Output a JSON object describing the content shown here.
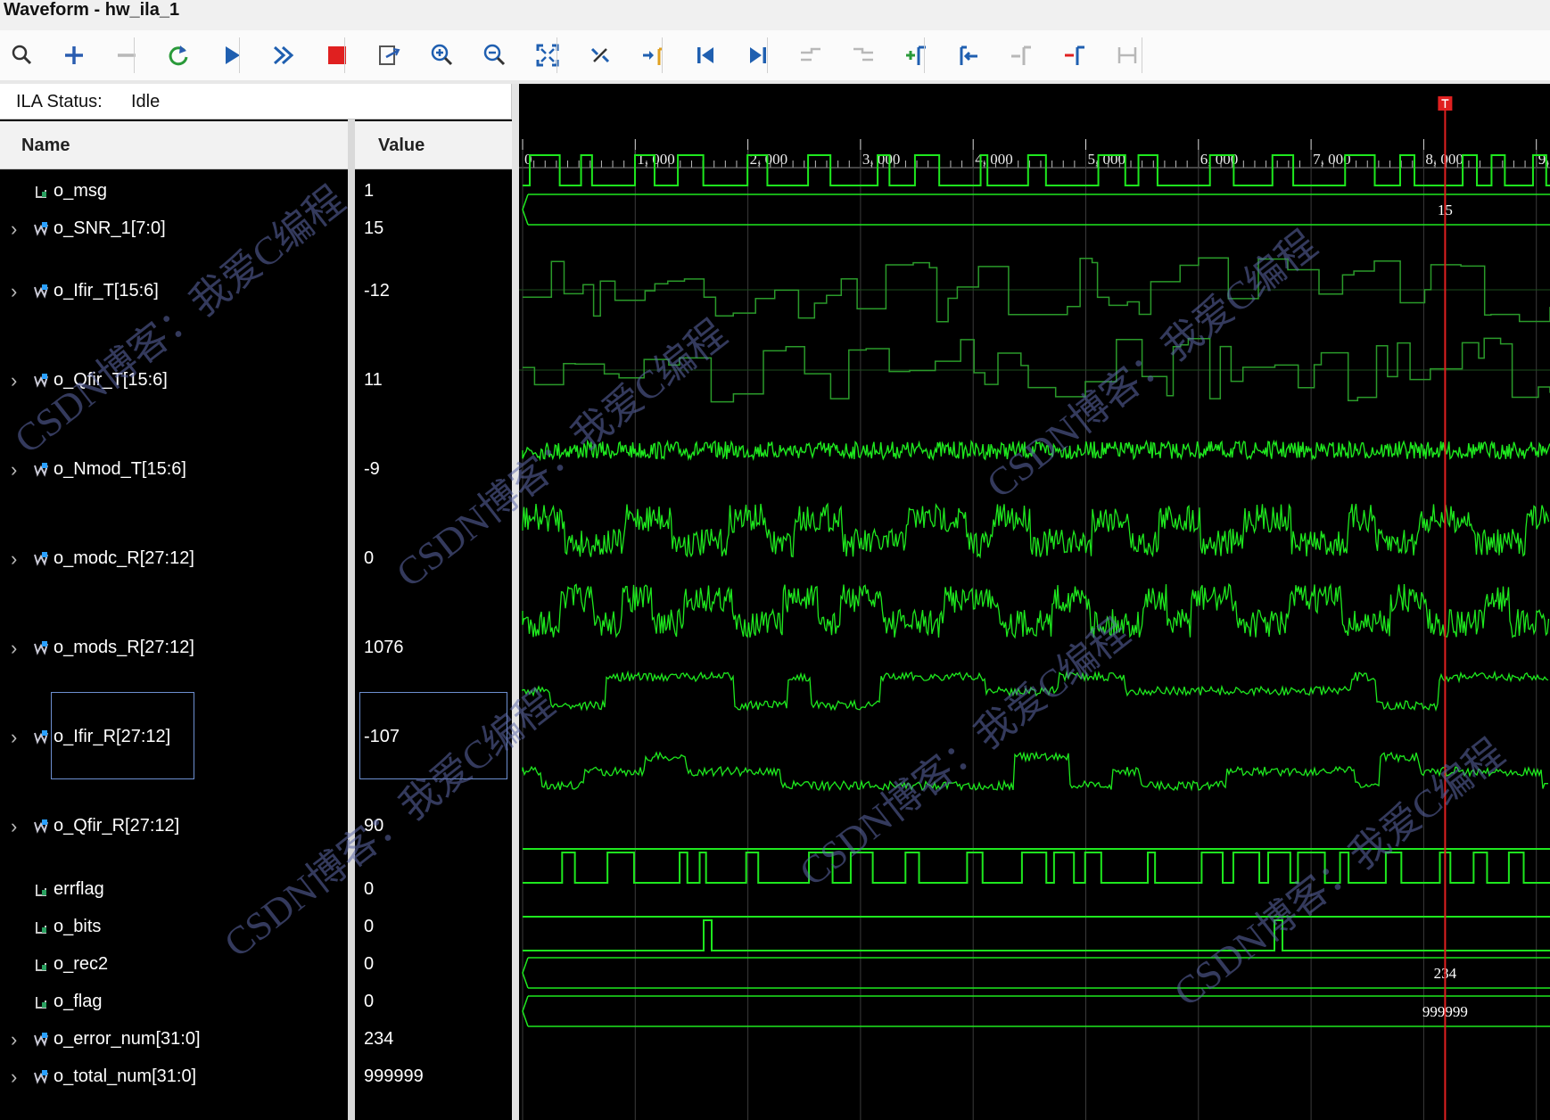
{
  "window": {
    "title": "Waveform - hw_ila_1"
  },
  "toolbar": {
    "buttons": [
      {
        "name": "search-button",
        "icon": "search-icon"
      },
      {
        "name": "add-button",
        "icon": "plus-icon"
      },
      {
        "name": "remove-button",
        "icon": "minus-icon"
      },
      {
        "name": "run-trigger-button",
        "icon": "refresh-icon"
      },
      {
        "name": "run-button",
        "icon": "play-icon"
      },
      {
        "name": "run-immediate-button",
        "icon": "fast-forward-icon"
      },
      {
        "name": "stop-button",
        "icon": "stop-icon"
      },
      {
        "name": "export-button",
        "icon": "export-icon"
      },
      {
        "name": "zoom-in-button",
        "icon": "zoom-in-icon"
      },
      {
        "name": "zoom-out-button",
        "icon": "zoom-out-icon"
      },
      {
        "name": "zoom-fit-button",
        "icon": "zoom-fit-icon"
      },
      {
        "name": "zoom-cursor-button",
        "icon": "cursor-zoom-icon"
      },
      {
        "name": "go-to-cursor-button",
        "icon": "go-to-cursor-icon"
      },
      {
        "name": "go-to-start-button",
        "icon": "go-to-start-icon"
      },
      {
        "name": "go-to-end-button",
        "icon": "go-to-end-icon"
      },
      {
        "name": "previous-transition-button",
        "icon": "previous-transition-icon"
      },
      {
        "name": "next-transition-button",
        "icon": "next-transition-icon"
      },
      {
        "name": "add-marker-button",
        "icon": "add-marker-icon"
      },
      {
        "name": "previous-marker-button",
        "icon": "previous-marker-icon"
      },
      {
        "name": "next-marker-button",
        "icon": "next-marker-icon"
      },
      {
        "name": "delete-marker-button",
        "icon": "delete-marker-icon"
      },
      {
        "name": "swap-cursors-button",
        "icon": "swap-cursors-icon"
      }
    ]
  },
  "status": {
    "label": "ILA Status:",
    "value": "Idle"
  },
  "columns": {
    "name": "Name",
    "value": "Value"
  },
  "signals": [
    {
      "name": "o_msg",
      "value": "1",
      "bus": false,
      "kind": "bit"
    },
    {
      "name": "o_SNR_1[7:0]",
      "value": "15",
      "bus": true,
      "kind": "busval"
    },
    {
      "name": "o_Ifir_T[15:6]",
      "value": "-12",
      "bus": true,
      "kind": "analog_step"
    },
    {
      "name": "o_Qfir_T[15:6]",
      "value": "11",
      "bus": true,
      "kind": "analog_step"
    },
    {
      "name": "o_Nmod_T[15:6]",
      "value": "-9",
      "bus": true,
      "kind": "noise"
    },
    {
      "name": "o_modc_R[27:12]",
      "value": "0",
      "bus": true,
      "kind": "noisy_bin"
    },
    {
      "name": "o_mods_R[27:12]",
      "value": "1076",
      "bus": true,
      "kind": "noisy_bin"
    },
    {
      "name": "o_Ifir_R[27:12]",
      "value": "-107",
      "bus": true,
      "kind": "noisy_step"
    },
    {
      "name": "o_Qfir_R[27:12]",
      "value": "90",
      "bus": true,
      "kind": "noisy_step"
    },
    {
      "name": "errflag",
      "value": "0",
      "bus": false,
      "kind": "bit"
    },
    {
      "name": "o_bits",
      "value": "0",
      "bus": false,
      "kind": "bit"
    },
    {
      "name": "o_rec2",
      "value": "0",
      "bus": false,
      "kind": "bit"
    },
    {
      "name": "o_flag",
      "value": "0",
      "bus": false,
      "kind": "bit"
    },
    {
      "name": "o_error_num[31:0]",
      "value": "234",
      "bus": true,
      "kind": "busval"
    },
    {
      "name": "o_total_num[31:0]",
      "value": "999999",
      "bus": true,
      "kind": "busval"
    }
  ],
  "waveform": {
    "ticks": [
      "0",
      "1, 000",
      "2, 000",
      "3, 000",
      "4, 000",
      "5, 000",
      "6, 000",
      "7, 000",
      "8, 000",
      "9,"
    ],
    "cursor_sample": 8190,
    "bus_labels": {
      "snr": "15",
      "error_num": "234",
      "total_num": "999999"
    },
    "colors": {
      "wave": "#1ee81e",
      "wave_dim": "#2a9a2a",
      "cursor": "#e02020",
      "grid": "#3a3a3a",
      "background": "#000000"
    }
  },
  "watermark": {
    "text": "CSDN博客：我爱C编程"
  }
}
